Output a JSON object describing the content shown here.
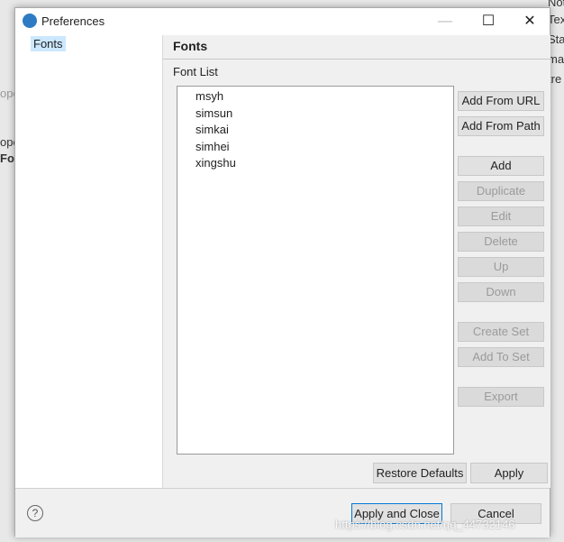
{
  "background": {
    "left_fragments": [
      "ope",
      "ope",
      "For"
    ],
    "right_fragments": [
      "Not",
      "Tex",
      "Stat",
      "ma",
      "tre"
    ]
  },
  "dialog": {
    "title": "Preferences",
    "tree": [
      "Fonts"
    ],
    "page_title": "Fonts",
    "font_list_label": "Font List",
    "fonts": [
      "msyh",
      "simsun",
      "simkai",
      "simhei",
      "xingshu"
    ],
    "buttons": [
      {
        "label": "Add From URL",
        "enabled": true
      },
      {
        "label": "Add From Path",
        "enabled": true
      },
      {
        "label": "Add",
        "enabled": true
      },
      {
        "label": "Duplicate",
        "enabled": false
      },
      {
        "label": "Edit",
        "enabled": false
      },
      {
        "label": "Delete",
        "enabled": false
      },
      {
        "label": "Up",
        "enabled": false
      },
      {
        "label": "Down",
        "enabled": false
      },
      {
        "label": "Create Set",
        "enabled": false
      },
      {
        "label": "Add To Set",
        "enabled": false
      },
      {
        "label": "Export",
        "enabled": false
      }
    ],
    "restore_defaults": "Restore Defaults",
    "apply": "Apply",
    "apply_and_close": "Apply and Close",
    "cancel": "Cancel",
    "help": "?"
  },
  "watermark": "https://blog.csdn.net/qq_44732146"
}
